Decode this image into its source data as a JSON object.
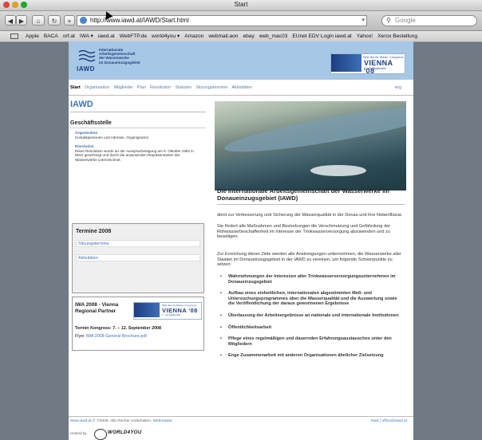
{
  "window": {
    "title": "Start"
  },
  "toolbar": {
    "back_icon": "back-arrow-icon",
    "forward_icon": "forward-arrow-icon",
    "home_icon": "home-icon",
    "reload_icon": "reload-icon",
    "add_icon": "plus-icon",
    "url": "http://www.iawd.at/IAWD/Start.html",
    "search_placeholder": "Google"
  },
  "bookmarks": [
    "Apple",
    "BACA",
    "orf.at",
    "IWA ▾",
    "iawd.at",
    "WebFTP.de",
    "world4you ▾",
    "Amazon",
    "webmail.aon",
    "ebay",
    "web_mac03",
    "EUnet EDV Login iawd.at",
    "Yahoo!",
    "Xerox Bestellung"
  ],
  "header": {
    "logo_lines": [
      "Internationale",
      "Arbeitsgemeinschaft",
      "der Wasserwerke",
      "im Donaueinzugsgebiet"
    ],
    "logo_acronym": "IAWD",
    "banner_top": "IWA World Water Congress",
    "banner_main": "VIENNA '08",
    "banner_date": "7 - 12 September"
  },
  "nav": {
    "items": [
      "Start",
      "Organisation",
      "Mitglieder",
      "Plan",
      "Resolution",
      "Statuten",
      "Sitzungstermine",
      "Aktivitäten"
    ],
    "right": "eng"
  },
  "left": {
    "heading": "IAWD",
    "section": "Geschäftsstelle",
    "org_title": "Organisation",
    "org_text": "Kontaktpersonen und Adresse, Organigramm",
    "res_title": "Resolution",
    "res_text": "Diese Resolution wurde an der Aussprachetagung am 6. Oktober 1992 in Wien genehmigt und durch die anwesenden Repräsentanten der Wasserwerke unterzeichnet."
  },
  "termine": {
    "title": "Termine 2008",
    "links": [
      "Sitzungstermine",
      "Aktivitäten"
    ]
  },
  "iwa": {
    "title": "IWA 2008 - Vienna Regional Partner",
    "dates": "Termin Kongress: 7. – 12. September 2008",
    "flyer_label": "Flyer",
    "flyer_link": "IWA 2008 General Brochure.pdf"
  },
  "main": {
    "title": "Die Internationale Arbeitsgemeinschaft der Wasserwerke im Donaueinzugsgebiet (IAWD)",
    "para1": "dient zur Verbesserung und Sicherung der Wasserqualität in der Donau und ihre Nebenflüsse.",
    "para2": "Sie fördert alle Maßnahmen und Bestrebungen die Verschmutzung und Gefährdung der Rohwasserbeschaffenheit im Interesse der Trinkwasserversorgung abzuwenden und zu beseitigen.",
    "para3": "Zur Erreichung dieser Ziele werden alle Anstrengungen unternommen, die Wasserwerke aller Staaten im Donaueinzugsgebiet in der IAWD zu vereinen, um folgende Schwerpunkte zu setzen:",
    "bullets": [
      "Wahrnehmungen der Interessen aller Trinkwasserversorgungsunternehmen im Donaueinzugsgebiet",
      "Aufbau eines einheitlichen, internationalen abgestimmten Meß- und Untersuchungsprogrammes über die Wasserqualität und die Auswertung sowie die Veröffentlichung der daraus gewonnenen Ergebnisse",
      "Überlassung der Arbeitsergebnisse an nationale und internationale Institutionen",
      "Öffentlichkeitsarbeit",
      "Pflege eines regelmäßigen und dauernden Erfahrungsaustausches unter den Mitgliedern",
      "Enge Zusammenarbeit mit anderen Organisationen ähnlicher Zielsetzung"
    ]
  },
  "footer": {
    "site": "www.iawd.at",
    "copyright": "© 7/2008. Alle Rechte vorbehalten.",
    "webmaster": "Webmaster",
    "right_start": "Start",
    "right_sep": "|",
    "right_email": "office@iawd.at",
    "hosted_by": "Hosted by",
    "host_name": "WORLD4YOU"
  }
}
